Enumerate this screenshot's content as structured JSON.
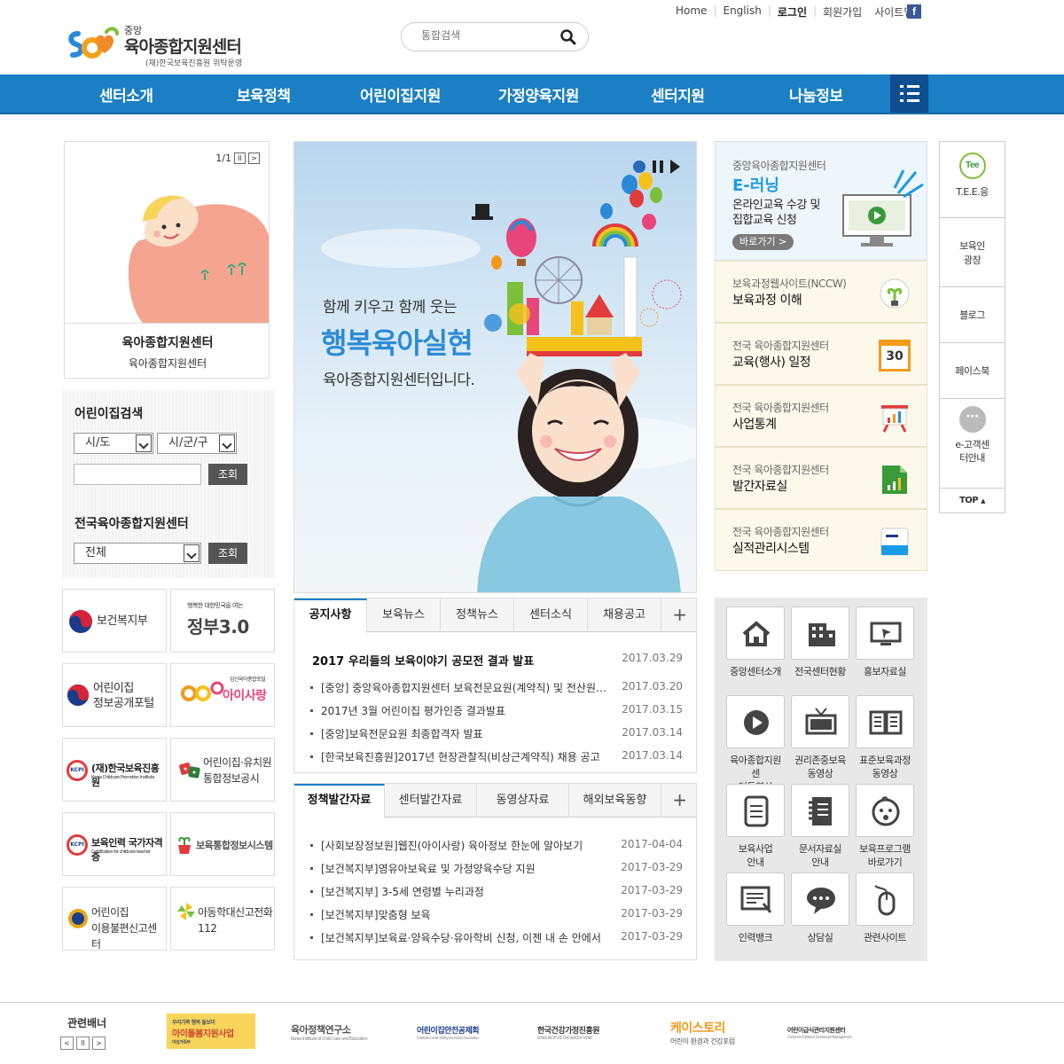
{
  "header": {
    "top_links": [
      "Home",
      "English",
      "로그인",
      "회원가입",
      "사이트맵"
    ],
    "facebook_label": "f",
    "logo_small": "중앙",
    "logo_main": "육아종합지원센터",
    "logo_sub": "(재)한국보육진흥원 위탁운영",
    "search_placeholder": "통합검색"
  },
  "nav": [
    "센터소개",
    "보육정책",
    "어린이집지원",
    "가정양육지원",
    "센터지원",
    "나눔정보"
  ],
  "left_banner": {
    "pager": "1/1",
    "pause_label": "II",
    "next_label": ">",
    "caption_title": "육아종합지원센터",
    "caption_sub": "육아종합지원센터"
  },
  "daycare_search": {
    "title": "어린이집검색",
    "sido": "시/도",
    "sigungu": "시/군/구",
    "button": "조회"
  },
  "center_search": {
    "title": "전국육아종합지원센터",
    "select": "전체",
    "button": "조회"
  },
  "link_tiles": [
    {
      "label": "보건복지부"
    },
    {
      "label": "정부3.0",
      "small": "행복한 대한민국을 여는"
    },
    {
      "label1": "어린이집",
      "label2": "정보공개포털"
    },
    {
      "label": "아이사랑",
      "small": "임신육아종합포털"
    },
    {
      "label": "(재)한국보육진흥원",
      "small": "Korea Childcare Promotion Institute"
    },
    {
      "label1": "어린이집·유치원",
      "label2": "통합정보공시"
    },
    {
      "label": "보육인력 국가자격증",
      "small": "Certification for childcare teacher"
    },
    {
      "label": "보육통합정보시스템"
    },
    {
      "label1": "어린이집",
      "label2": "이용불편신고센터"
    },
    {
      "label1": "아동학대신고전화",
      "label2": "112"
    }
  ],
  "visual": {
    "line1": "함께 키우고 함께 웃는",
    "line2": "행복육아실현",
    "line3": "육아종합지원센터입니다."
  },
  "notice_board": {
    "tabs": [
      "공지사항",
      "보육뉴스",
      "정책뉴스",
      "센터소식",
      "채용공고"
    ],
    "plus": "+",
    "headline": {
      "title": "2017 우리들의 보육이야기 공모전 결과 발표",
      "date": "2017.03.29"
    },
    "items": [
      {
        "title": "[중앙] 중앙육아종합지원센터 보육전문요원(계약직) 및 전산원…",
        "date": "2017.03.20"
      },
      {
        "title": "2017년 3월 어린이집 평가인증 결과발표",
        "date": "2017.03.15"
      },
      {
        "title": "[중앙]보육전문요원 최종합격자 발표",
        "date": "2017.03.14"
      },
      {
        "title": "[한국보육진흥원]2017년 현장관찰직(비상근계약직) 채용 공고",
        "date": "2017.03.14"
      }
    ]
  },
  "policy_board": {
    "tabs": [
      "정책발간자료",
      "센터발간자료",
      "동영상자료",
      "해외보육동향"
    ],
    "plus": "+",
    "items": [
      {
        "title": "[사회보장정보원]웹진(아이사랑) 육아정보 한눈에 알아보기",
        "date": "2017-04-04"
      },
      {
        "title": "[보건복지부]영유아보육료 및 가정양육수당 지원",
        "date": "2017-03-29"
      },
      {
        "title": "[보건복지부] 3-5세 연령별 누리과정",
        "date": "2017-03-29"
      },
      {
        "title": "[보건복지부]맞춤형 보육",
        "date": "2017-03-29"
      },
      {
        "title": "[보건복지부]보육료·양육수당·유아학비 신청, 이젠 내 손 안에서",
        "date": "2017-03-29"
      }
    ]
  },
  "elearning": {
    "small": "중앙육아종합지원센터",
    "title": "E-러닝",
    "desc1": "온라인교육 수강 및",
    "desc2": "집합교육 신청",
    "button": "바로가기 >"
  },
  "right_tiles": [
    {
      "small": "보육과정웹사이트(NCCW)",
      "big": "보육과정 이해",
      "icon": "seedling-bulb-icon"
    },
    {
      "small": "전국 육아종합지원센터",
      "big": "교육(행사) 일정",
      "icon": "calendar-icon",
      "icon_text": "30"
    },
    {
      "small": "전국 육아종합지원센터",
      "big": "사업통계",
      "icon": "easel-chart-icon"
    },
    {
      "small": "전국 육아종합지원센터",
      "big": "발간자료실",
      "icon": "document-chart-icon"
    },
    {
      "small": "전국 육아종합지원센터",
      "big": "실적관리시스템",
      "icon": "card-icon"
    }
  ],
  "quick_menu": [
    {
      "label1": "중앙센터소개",
      "label2": "",
      "icon": "home-icon"
    },
    {
      "label1": "전국센터현황",
      "label2": "",
      "icon": "building-icon"
    },
    {
      "label1": "홍보자료실",
      "label2": "",
      "icon": "monitor-icon"
    },
    {
      "label1": "육아종합지원센",
      "label2": "터동영상",
      "icon": "play-icon"
    },
    {
      "label1": "권리존중보육",
      "label2": "동영상",
      "icon": "tv-icon"
    },
    {
      "label1": "표준보육과정",
      "label2": "동영상",
      "icon": "book-icon"
    },
    {
      "label1": "보육사업",
      "label2": "안내",
      "icon": "document-icon"
    },
    {
      "label1": "문서자료실",
      "label2": "안내",
      "icon": "notebook-icon"
    },
    {
      "label1": "보육프로그램",
      "label2": "바로가기",
      "icon": "baby-icon"
    },
    {
      "label1": "인력뱅크",
      "label2": "",
      "icon": "board-icon"
    },
    {
      "label1": "상담실",
      "label2": "",
      "icon": "chat-icon"
    },
    {
      "label1": "관련사이트",
      "label2": "",
      "icon": "mouse-icon"
    }
  ],
  "side_quick": {
    "tee_badge": "Tee",
    "tee": "T.E.E.응",
    "square1": "보육인",
    "square2": "광장",
    "blog": "블로그",
    "facebook": "페이스북",
    "ecs_badge": "···",
    "ecs1": "e-고객센",
    "ecs2": "터안내",
    "top": "TOP"
  },
  "footer": {
    "title": "관련배너",
    "prev_label": "<",
    "pause_label": "II",
    "next_label": ">",
    "banners": [
      {
        "top": "우리가족 행복 돌보미",
        "name": "아이돌봄지원사업",
        "tag": "여성가족부"
      },
      {
        "name": "육아정책연구소",
        "sub": "Korea Institute of Child Care and Education"
      },
      {
        "name": "어린이집안전공제회",
        "sub": "Childcare center Safety Insurance Association"
      },
      {
        "name": "한국건강가정진흥원",
        "sub": "KOREA INSTITUTE FOR HEALTHY FAMILY"
      },
      {
        "name": "케이스토리",
        "sub": "어린이 환경과 건강포럼"
      },
      {
        "name": "어린이급식관리지원센터",
        "sub": "Center for Children's Foodservice Management"
      }
    ]
  },
  "colors": {
    "nav_blue": "#1a7fc4",
    "nav_menu": "#0f4f8f",
    "tile_cream": "#fdf9ea",
    "elearning_blue": "#1a9be6"
  }
}
